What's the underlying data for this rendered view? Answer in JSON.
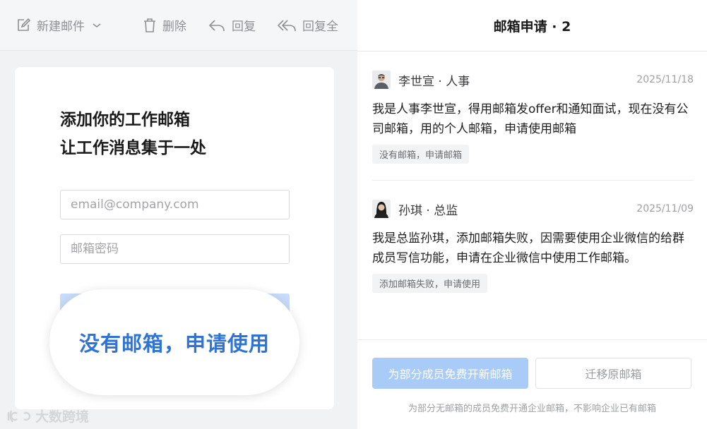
{
  "toolbar": {
    "new_mail": "新建邮件",
    "delete": "删除",
    "reply": "回复",
    "reply_all": "回复全"
  },
  "login_card": {
    "title_line1": "添加你的工作邮箱",
    "title_line2": "让工作消息集于一处",
    "email_placeholder": "email@company.com",
    "password_placeholder": "邮箱密码",
    "apply_link": "没有邮箱，申请使用"
  },
  "watermark": "大数跨境",
  "panel": {
    "title": "邮箱申请 · 2",
    "requests": [
      {
        "name": "李世宣 · 人事",
        "date": "2025/11/18",
        "message": "我是人事李世宣，得用邮箱发offer和通知面试，现在没有公司邮箱，用的个人邮箱，申请使用邮箱",
        "tag": "没有邮箱，申请邮箱"
      },
      {
        "name": "孙琪 · 总监",
        "date": "2025/11/09",
        "message": "我是总监孙琪，添加邮箱失败，因需要使用企业微信的给群成员写信功能，申请在企业微信中使用工作邮箱。",
        "tag": "添加邮箱失败，申请使用"
      }
    ],
    "open_button": "为部分成员免费开新邮箱",
    "migrate_button": "迁移原邮箱",
    "footer_note": "为部分无邮箱的成员免费开通企业邮箱，不影响企业已有邮箱"
  },
  "colors": {
    "accent": "#2f73d6",
    "primary_disabled": "#a9cbf7"
  }
}
